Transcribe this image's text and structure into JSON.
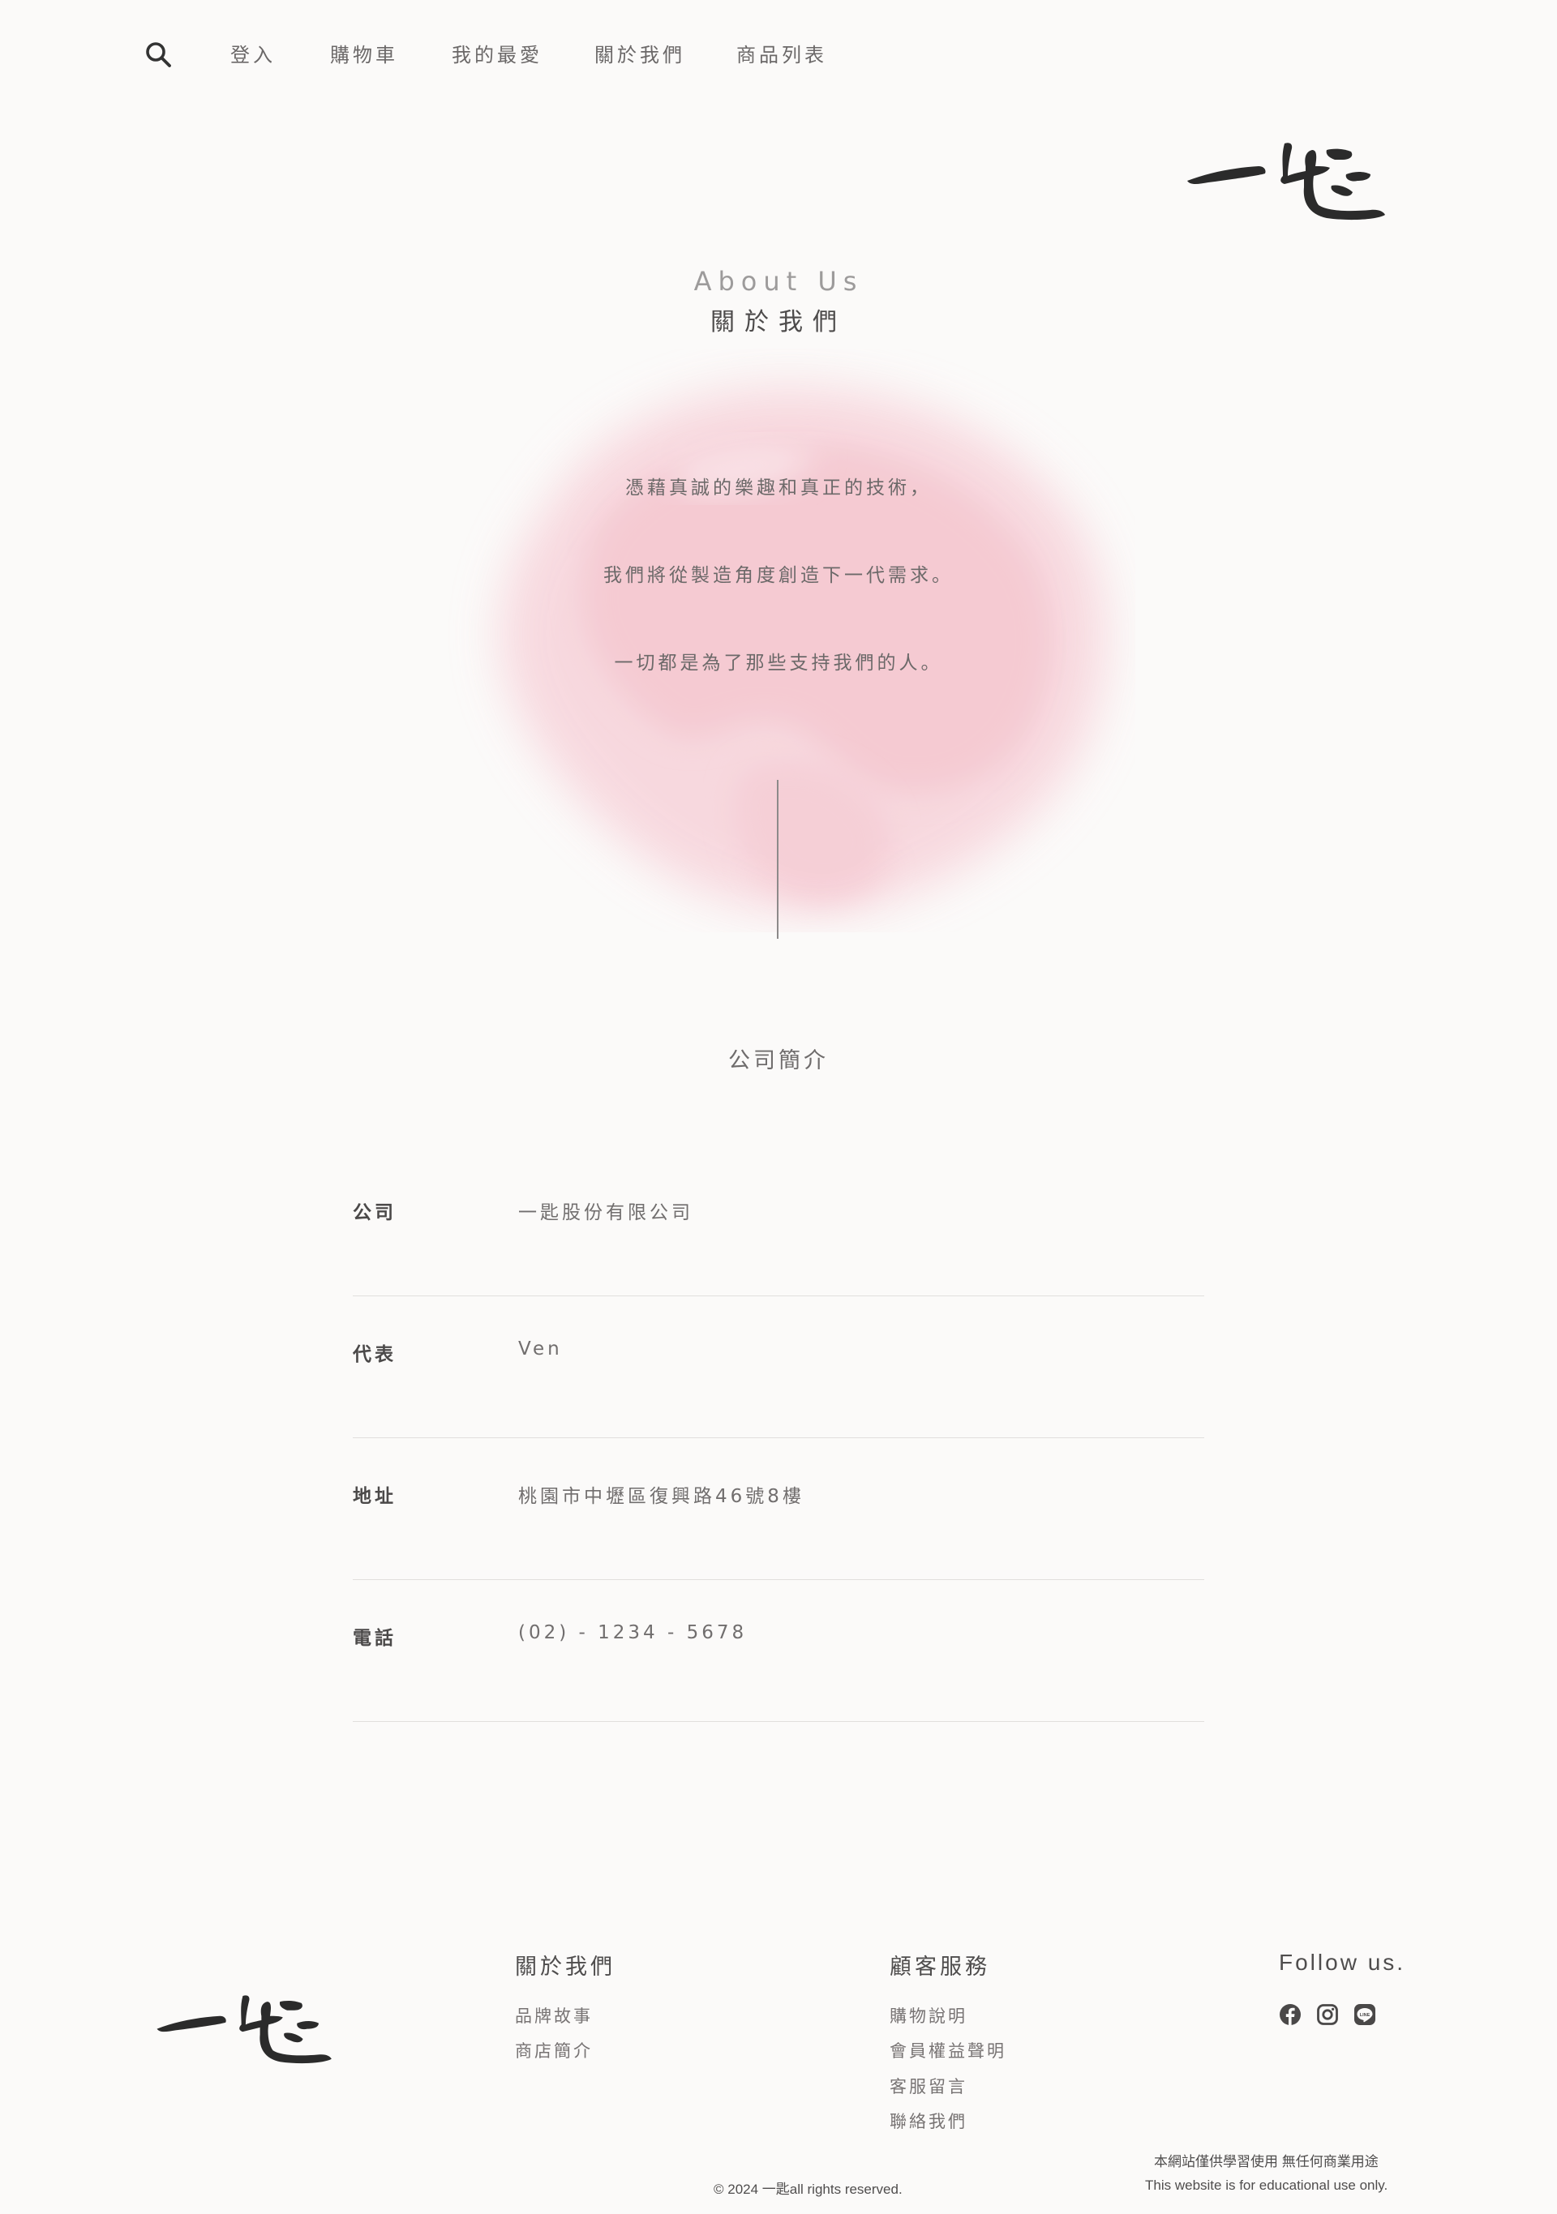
{
  "nav": {
    "items": [
      {
        "label": "登入"
      },
      {
        "label": "購物車"
      },
      {
        "label": "我的最愛"
      },
      {
        "label": "關於我們"
      },
      {
        "label": "商品列表"
      }
    ]
  },
  "hero": {
    "title_en": "About Us",
    "title_zh": "關於我們",
    "lines": [
      "憑藉真誠的樂趣和真正的技術，",
      "我們將從製造角度創造下一代需求。",
      "一切都是為了那些支持我們的人。"
    ]
  },
  "company": {
    "title": "公司簡介",
    "rows": [
      {
        "label": "公司",
        "value": "一匙股份有限公司"
      },
      {
        "label": "代表",
        "value": "Ven"
      },
      {
        "label": "地址",
        "value": "桃園市中壢區復興路46號8樓"
      },
      {
        "label": "電話",
        "value": "(02) - 1234 - 5678"
      }
    ]
  },
  "footer": {
    "about": {
      "heading": "關於我們",
      "links": [
        "品牌故事",
        "商店簡介"
      ]
    },
    "service": {
      "heading": "顧客服務",
      "links": [
        "購物說明",
        "會員權益聲明",
        "客服留言",
        "聯絡我們"
      ]
    },
    "follow": {
      "heading": "Follow us."
    },
    "social_icons": [
      "facebook-icon",
      "instagram-icon",
      "line-icon"
    ],
    "copyright": "© 2024 一匙all rights reserved.",
    "note_zh": "本網站僅供學習使用 無任何商業用途",
    "note_en": "This website is for educational use only."
  },
  "colors": {
    "background": "#fbfaf9",
    "watercolor_pink": "#f5c5cf",
    "text": "#595757",
    "brush_logo": "#2b2b2b"
  }
}
